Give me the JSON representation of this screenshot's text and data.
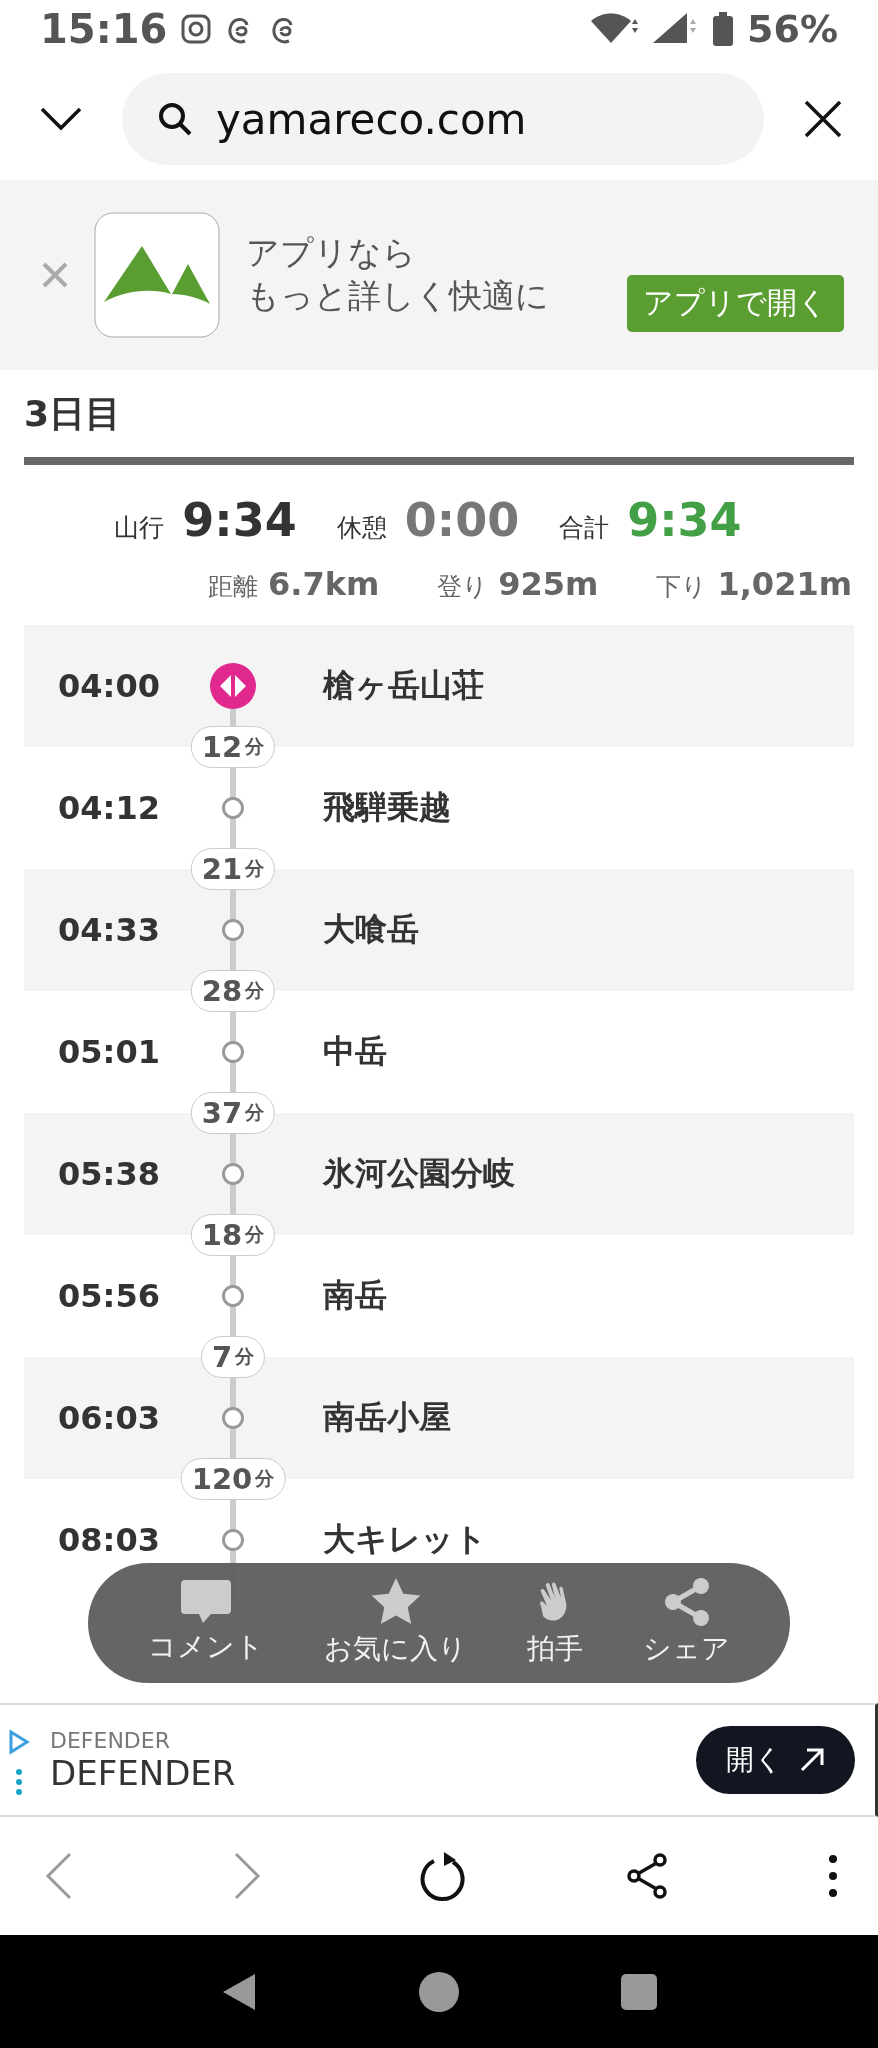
{
  "status_bar": {
    "time": "15:16",
    "battery": "56%"
  },
  "url_bar": {
    "url": "yamareco.com"
  },
  "app_banner": {
    "line_1": "アプリなら",
    "line_2": "もっと詳しく快適に",
    "button": "アプリで開く"
  },
  "day": {
    "title": "3日目"
  },
  "summary": [
    {
      "label": "山行",
      "value": "9:34",
      "color": "#333333"
    },
    {
      "label": "休憩",
      "value": "0:00",
      "color": "#777777"
    },
    {
      "label": "合計",
      "value": "9:34",
      "color": "#43a047"
    }
  ],
  "stats": [
    {
      "label": "距離",
      "value": "6.7km"
    },
    {
      "label": "登り",
      "value": "925m"
    },
    {
      "label": "下り",
      "value": "1,021m"
    }
  ],
  "timeline": [
    {
      "time": "04:00",
      "name": "槍ヶ岳山荘",
      "kind": "start"
    },
    {
      "time": "04:12",
      "name": "飛騨乗越",
      "kind": "waypoint",
      "duration": "12",
      "unit": "分"
    },
    {
      "time": "04:33",
      "name": "大喰岳",
      "kind": "waypoint",
      "duration": "21",
      "unit": "分"
    },
    {
      "time": "05:01",
      "name": "中岳",
      "kind": "waypoint",
      "duration": "28",
      "unit": "分"
    },
    {
      "time": "05:38",
      "name": "氷河公園分岐",
      "kind": "waypoint",
      "duration": "37",
      "unit": "分"
    },
    {
      "time": "05:56",
      "name": "南岳",
      "kind": "waypoint",
      "duration": "18",
      "unit": "分"
    },
    {
      "time": "06:03",
      "name": "南岳小屋",
      "kind": "waypoint",
      "duration": "7",
      "unit": "分"
    },
    {
      "time": "08:03",
      "name": "大キレット",
      "kind": "waypoint",
      "duration": "120",
      "unit": "分"
    }
  ],
  "action_bar": [
    {
      "label": "コメント",
      "kind": "comment"
    },
    {
      "label": "お気に入り",
      "kind": "favorite"
    },
    {
      "label": "拍手",
      "kind": "clap"
    },
    {
      "label": "シェア",
      "kind": "share"
    }
  ],
  "ad": {
    "advertiser": "DEFENDER",
    "title": "DEFENDER",
    "button": "開く"
  }
}
